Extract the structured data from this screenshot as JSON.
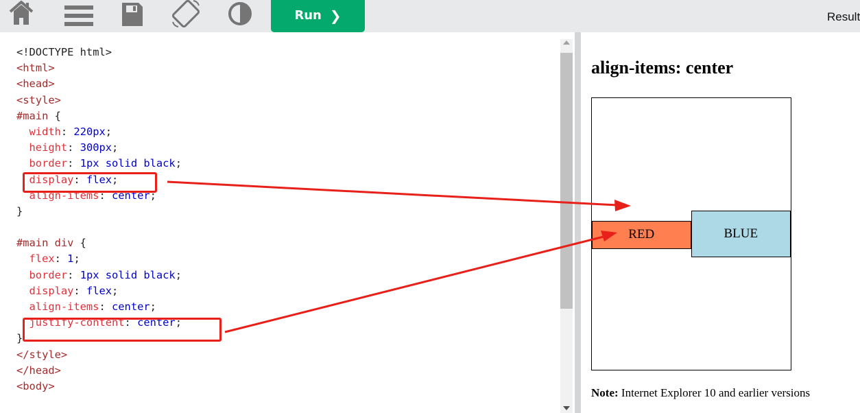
{
  "toolbar": {
    "icons": [
      "home-icon",
      "menu-icon",
      "save-icon",
      "rotate-icon",
      "contrast-icon"
    ],
    "run_label": "Run",
    "run_chevron": "❯",
    "result_label": "Result"
  },
  "editor": {
    "lines": [
      [
        {
          "t": "<!DOCTYPE html>",
          "c": "punc"
        }
      ],
      [
        {
          "t": "<",
          "c": "tag"
        },
        {
          "t": "html",
          "c": "tag"
        },
        {
          "t": ">",
          "c": "tag"
        }
      ],
      [
        {
          "t": "<",
          "c": "tag"
        },
        {
          "t": "head",
          "c": "tag"
        },
        {
          "t": ">",
          "c": "tag"
        }
      ],
      [
        {
          "t": "<",
          "c": "tag"
        },
        {
          "t": "style",
          "c": "tag"
        },
        {
          "t": ">",
          "c": "tag"
        }
      ],
      [
        {
          "t": "#main",
          "c": "sel"
        },
        {
          "t": " {",
          "c": "punc"
        }
      ],
      [
        {
          "t": "  width",
          "c": "prop"
        },
        {
          "t": ": ",
          "c": "punc"
        },
        {
          "t": "220px",
          "c": "val"
        },
        {
          "t": ";",
          "c": "punc"
        }
      ],
      [
        {
          "t": "  height",
          "c": "prop"
        },
        {
          "t": ": ",
          "c": "punc"
        },
        {
          "t": "300px",
          "c": "val"
        },
        {
          "t": ";",
          "c": "punc"
        }
      ],
      [
        {
          "t": "  border",
          "c": "prop"
        },
        {
          "t": ": ",
          "c": "punc"
        },
        {
          "t": "1px solid black",
          "c": "val"
        },
        {
          "t": ";",
          "c": "punc"
        }
      ],
      [
        {
          "t": "  display",
          "c": "prop"
        },
        {
          "t": ": ",
          "c": "punc"
        },
        {
          "t": "flex",
          "c": "val"
        },
        {
          "t": ";",
          "c": "punc"
        }
      ],
      [
        {
          "t": "  align-items",
          "c": "prop"
        },
        {
          "t": ": ",
          "c": "punc"
        },
        {
          "t": "center",
          "c": "val"
        },
        {
          "t": ";",
          "c": "punc"
        }
      ],
      [
        {
          "t": "}",
          "c": "punc"
        }
      ],
      [
        {
          "t": "",
          "c": "punc"
        }
      ],
      [
        {
          "t": "#main div",
          "c": "sel"
        },
        {
          "t": " {",
          "c": "punc"
        }
      ],
      [
        {
          "t": "  flex",
          "c": "prop"
        },
        {
          "t": ": ",
          "c": "punc"
        },
        {
          "t": "1",
          "c": "val"
        },
        {
          "t": ";",
          "c": "punc"
        }
      ],
      [
        {
          "t": "  border",
          "c": "prop"
        },
        {
          "t": ": ",
          "c": "punc"
        },
        {
          "t": "1px solid black",
          "c": "val"
        },
        {
          "t": ";",
          "c": "punc"
        }
      ],
      [
        {
          "t": "  display",
          "c": "prop"
        },
        {
          "t": ": ",
          "c": "punc"
        },
        {
          "t": "flex",
          "c": "val"
        },
        {
          "t": ";",
          "c": "punc"
        }
      ],
      [
        {
          "t": "  align-items",
          "c": "prop"
        },
        {
          "t": ": ",
          "c": "punc"
        },
        {
          "t": "center",
          "c": "val"
        },
        {
          "t": ";",
          "c": "punc"
        }
      ],
      [
        {
          "t": "  justify-content",
          "c": "prop"
        },
        {
          "t": ": ",
          "c": "punc"
        },
        {
          "t": "center",
          "c": "val"
        },
        {
          "t": ";",
          "c": "punc"
        }
      ],
      [
        {
          "t": "}",
          "c": "punc"
        }
      ],
      [
        {
          "t": "</",
          "c": "tag"
        },
        {
          "t": "style",
          "c": "tag"
        },
        {
          "t": ">",
          "c": "tag"
        }
      ],
      [
        {
          "t": "</",
          "c": "tag"
        },
        {
          "t": "head",
          "c": "tag"
        },
        {
          "t": ">",
          "c": "tag"
        }
      ],
      [
        {
          "t": "<",
          "c": "tag"
        },
        {
          "t": "body",
          "c": "tag"
        },
        {
          "t": ">",
          "c": "tag"
        }
      ]
    ]
  },
  "result": {
    "heading": "align-items: center",
    "red_label": "RED",
    "blue_label": "BLUE",
    "note_bold": "Note:",
    "note_text": " Internet Explorer 10 and earlier versions"
  },
  "colors": {
    "run_green": "#04aa6d",
    "annotation_red": "#e8201a",
    "red_box": "#ff7f50",
    "blue_box": "#add8e6"
  }
}
